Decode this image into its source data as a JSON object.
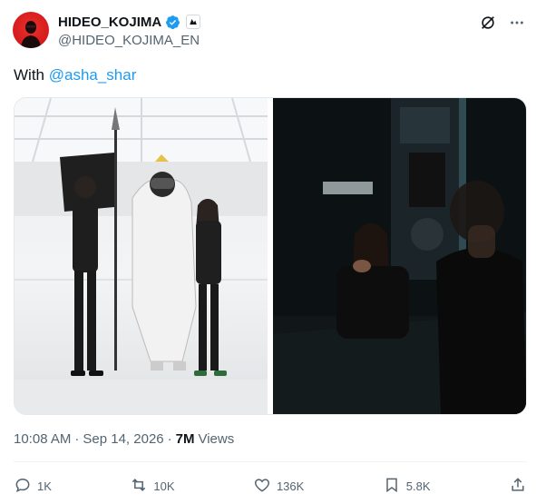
{
  "author": {
    "display_name": "HIDEO_KOJIMA",
    "handle": "@HIDEO_KOJIMA_EN",
    "verified_color": "#1d9bf0"
  },
  "tweet": {
    "text_prefix": "With ",
    "mention": "@asha_shar",
    "time": "10:08 AM",
    "separator": "·",
    "date": "Sep 14, 2026",
    "separator2": "·",
    "views_count": "7M",
    "views_label": "Views"
  },
  "media": {
    "photos": [
      {
        "name": "photo-left",
        "icon": "photo"
      },
      {
        "name": "photo-right",
        "icon": "photo"
      }
    ]
  },
  "actions": {
    "reply_count": "1K",
    "repost_count": "10K",
    "like_count": "136K",
    "bookmark_count": "5.8K"
  },
  "colors": {
    "accent": "#1d9bf0",
    "secondary_text": "#536471",
    "avatar_bg": "#d81e1e"
  }
}
